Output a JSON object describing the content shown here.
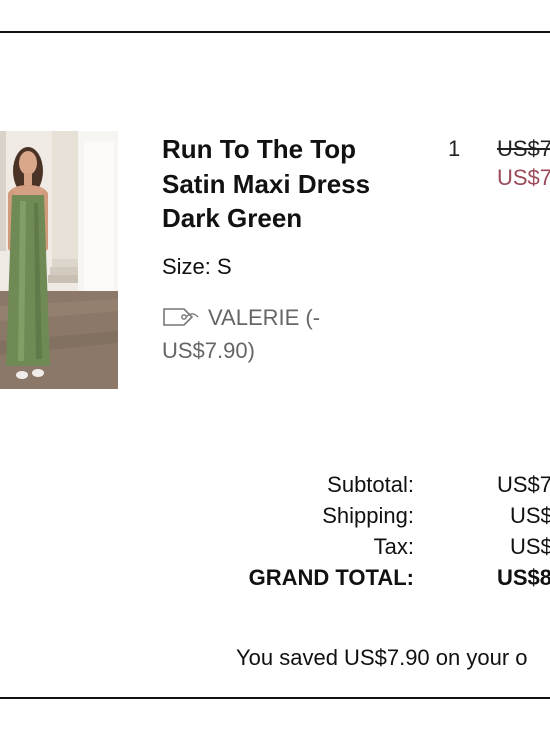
{
  "item": {
    "title": "Run To The Top Satin Maxi Dress Dark Green",
    "size_text": "Size: S",
    "discount_text": "VALERIE (- US$7.90)",
    "quantity": "1",
    "original_price": "US$7",
    "sale_price": "US$7",
    "sale_color": "#9b4a58"
  },
  "totals": {
    "subtotal_label": "Subtotal:",
    "subtotal_value": "US$7",
    "shipping_label": "Shipping:",
    "shipping_value": "US$",
    "tax_label": "Tax:",
    "tax_value": "US$",
    "grand_label": "GRAND TOTAL:",
    "grand_value": "US$8"
  },
  "savings_message": "You saved US$7.90 on your o"
}
